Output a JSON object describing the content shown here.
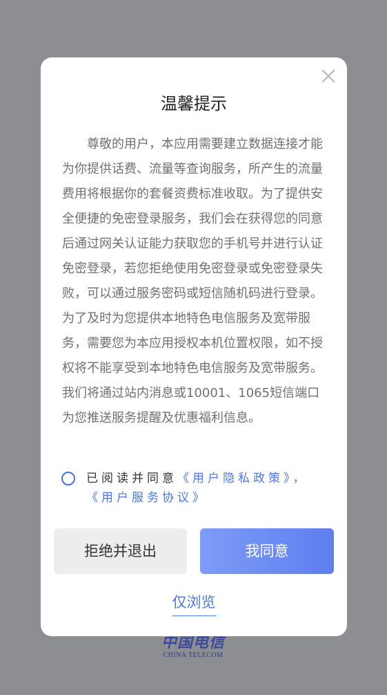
{
  "dialog": {
    "title": "温馨提示",
    "body": "尊敬的用户，本应用需要建立数据连接才能为你提供话费、流量等查询服务，所产生的流量费用将根据你的套餐资费标准收取。为了提供安全便捷的免密登录服务，我们会在获得您的同意后通过网关认证能力获取您的手机号并进行认证免密登录，若您拒绝使用免密登录或免密登录失败，可以通过服务密码或短信随机码进行登录。为了及时为您提供本地特色电信服务及宽带服务，需要您为本应用授权本机位置权限，如不授权将不能享受到本地特色电信服务及宽带服务。我们将通过站内消息或10001、1065短信端口为您推送服务提醒及优惠福利信息。",
    "consent_prefix": "已阅读并同意",
    "privacy_policy_link": "《用户隐私政策》",
    "consent_separator": "，",
    "service_agreement_link": "《用户服务协议》",
    "refuse_label": "拒绝并退出",
    "agree_label": "我同意",
    "browse_label": "仅浏览"
  },
  "brand": {
    "name_cn": "中国电信",
    "name_en": "CHINA TELECOM"
  },
  "colors": {
    "overlay": "#8d8e92",
    "accent": "#4a78e6",
    "agree_gradient_start": "#7e9cf6",
    "agree_gradient_end": "#5e7ef0"
  },
  "icons": {
    "close": "close-icon",
    "radio": "radio-unchecked-icon"
  }
}
